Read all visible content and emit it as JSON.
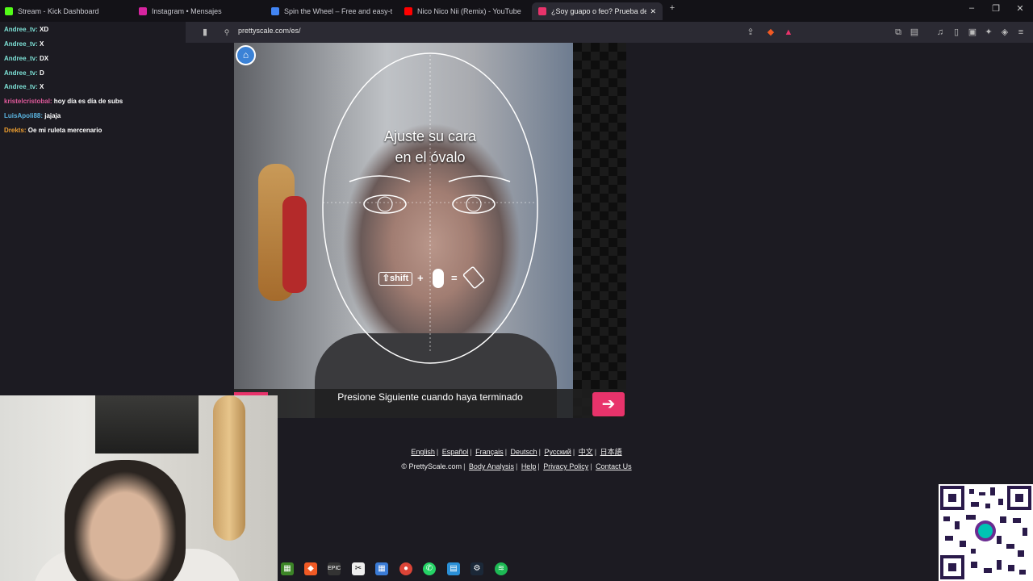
{
  "tabs": [
    {
      "label": "Stream - Kick Dashboard",
      "color": "#53fc18"
    },
    {
      "label": "Instagram • Mensajes",
      "color": "#d6249f"
    },
    {
      "label": "Spin the Wheel – Free and easy-to-u",
      "color": "#4285f4"
    },
    {
      "label": "Nico Nico Nii (Remix) - YouTube",
      "color": "#ff0000"
    },
    {
      "label": "¿Soy guapo o feo? Prueba de ar",
      "color": "#e8336b"
    }
  ],
  "address": {
    "url": "prettyscale.com/es/"
  },
  "chat": [
    {
      "user": "Andree_tv:",
      "msg": " XD"
    },
    {
      "user": "Andree_tv:",
      "msg": " X"
    },
    {
      "user": "Andree_tv:",
      "msg": " DX"
    },
    {
      "user": "Andree_tv:",
      "msg": " D"
    },
    {
      "user": "Andree_tv:",
      "msg": " X"
    },
    {
      "user": "kristelcristobal:",
      "msg": " hoy día es día de subs",
      "color": "#e05a9b"
    },
    {
      "user": "LuisApoli88:",
      "msg": " jajaja",
      "color": "#5ab4e0"
    },
    {
      "user": "Drekts:",
      "msg": " Oe mi ruleta mercenario",
      "color": "#f0a030"
    }
  ],
  "overlay": {
    "title_line1": "Ajuste su cara",
    "title_line2": "en el óvalo",
    "shift": "⇧shift",
    "plus": "+",
    "equals": "="
  },
  "instruction": "Presione Siguiente cuando haya terminado",
  "footer": {
    "languages": [
      "English",
      "Español",
      "Français",
      "Deutsch",
      "Русский",
      "中文",
      "日本語"
    ],
    "copyright": "© PrettyScale.com",
    "links": [
      "Body Analysis",
      "Help",
      "Privacy Policy",
      "Contact Us"
    ]
  },
  "colors": {
    "accent": "#e8336b",
    "home": "#3b82d6"
  }
}
